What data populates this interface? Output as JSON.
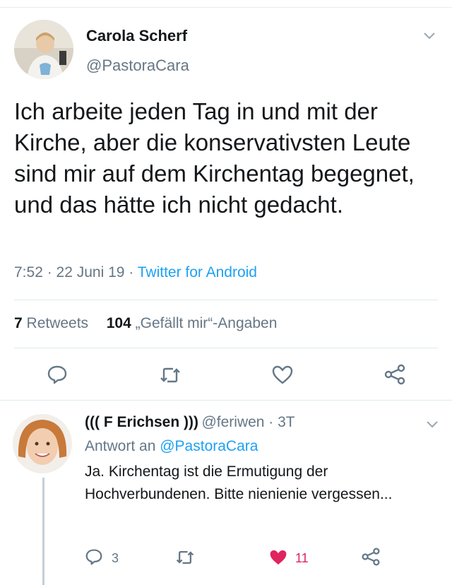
{
  "tweet": {
    "author_name": "Carola Scherf",
    "author_handle": "@PastoraCara",
    "text": "Ich arbeite jeden Tag in und mit der Kirche, aber die konservativsten Leute sind mir auf dem Kirchentag begegnet, und das hätte ich nicht gedacht.",
    "timestamp": "7:52 · 22 Juni 19 · ",
    "source": "Twitter for Android",
    "retweets_count": "7",
    "retweets_label": " Retweets",
    "likes_count": "104",
    "likes_label": " „Gefällt mir“-Angaben"
  },
  "reply": {
    "author_name": "((( F Erichsen )))",
    "author_handle": "@feriwen · 3T",
    "reply_to_prefix": "Antwort an ",
    "reply_to_handle": "@PastoraCara",
    "text": "Ja. Kirchentag ist die Ermutigung der Hochverbundenen. Bitte nienienie vergessen...",
    "reply_count": "3",
    "like_count": "11"
  },
  "colors": {
    "accent": "#1da1f2",
    "muted": "#657786",
    "like_active": "#e0245e"
  },
  "icons": [
    "chevron-down-icon",
    "reply-icon",
    "retweet-icon",
    "like-icon",
    "share-icon"
  ]
}
